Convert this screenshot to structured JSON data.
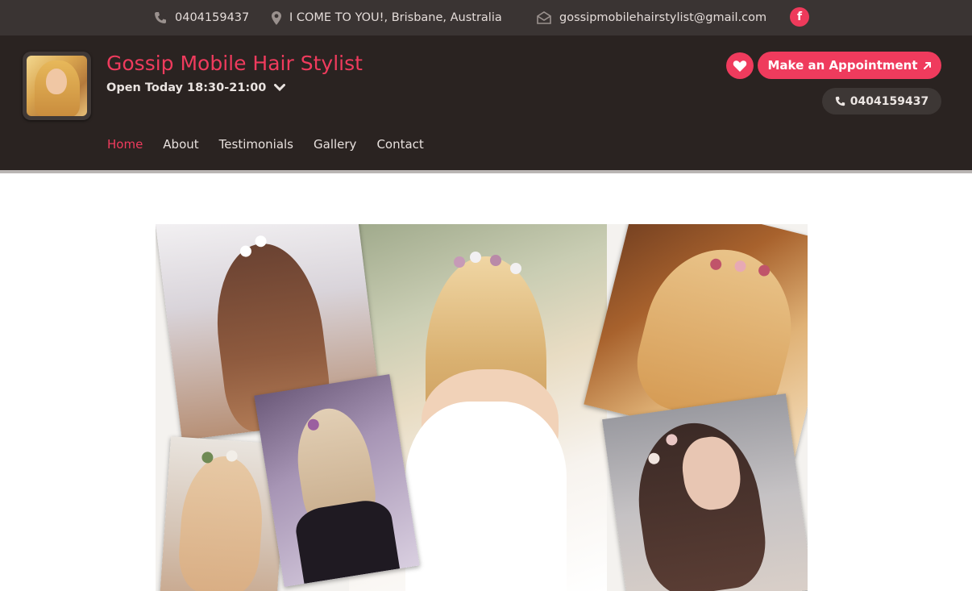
{
  "topbar": {
    "phone": "0404159437",
    "location": "I COME TO YOU!, Brisbane, Australia",
    "email": "gossipmobilehairstylist@gmail.com",
    "facebook_glyph": "f"
  },
  "header": {
    "title": "Gossip Mobile Hair Stylist",
    "hours": "Open Today 18:30-21:00",
    "appointment_label": "Make an Appointment",
    "phone_button": "0404159437"
  },
  "nav": {
    "items": [
      "Home",
      "About",
      "Testimonials",
      "Gallery",
      "Contact"
    ],
    "active": "Home"
  },
  "colors": {
    "accent": "#ef3b5d",
    "header_bg": "#2a2321",
    "topbar_bg": "#3a3433"
  },
  "icons": {
    "phone": "phone-icon",
    "location": "map-pin-icon",
    "email": "envelope-icon",
    "facebook": "facebook-icon",
    "favorite": "heart-icon",
    "dropdown": "chevron-down-icon",
    "external": "arrow-up-right-icon"
  }
}
